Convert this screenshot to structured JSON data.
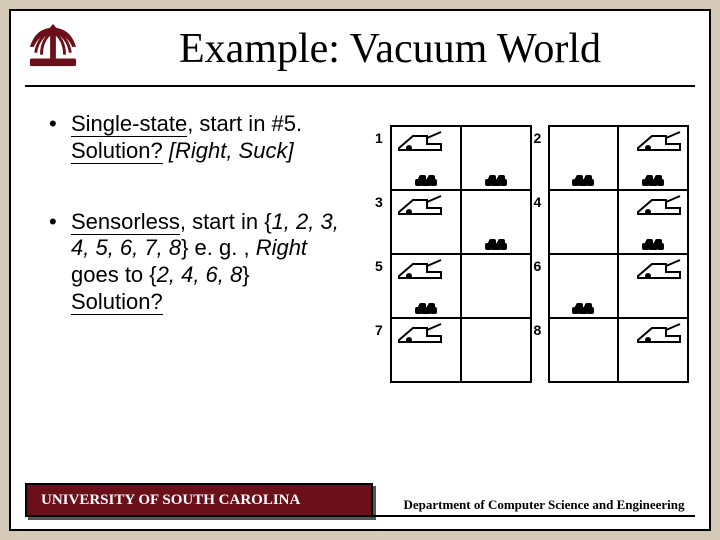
{
  "title": "Example: Vacuum World",
  "bullets": [
    {
      "lead": "Single-state",
      "tail1": ", start in #5.",
      "q": "Solution?",
      "ans": " [Right, Suck]"
    },
    {
      "lead": "Sensorless",
      "tail1": ", start in {",
      "set1": "1, 2, 3, 4, 5, 6, 7, 8",
      "tail2": "} e. g. , ",
      "right": "Right",
      "tail3": " goes to {",
      "set2": "2, 4, 6, 8",
      "tail4": "}",
      "q": "Solution?"
    }
  ],
  "states": [
    {
      "n": 1,
      "vac": "L",
      "dirtL": true,
      "dirtR": true
    },
    {
      "n": 2,
      "vac": "R",
      "dirtL": true,
      "dirtR": true
    },
    {
      "n": 3,
      "vac": "L",
      "dirtL": false,
      "dirtR": true
    },
    {
      "n": 4,
      "vac": "R",
      "dirtL": false,
      "dirtR": true
    },
    {
      "n": 5,
      "vac": "L",
      "dirtL": true,
      "dirtR": false
    },
    {
      "n": 6,
      "vac": "R",
      "dirtL": true,
      "dirtR": false
    },
    {
      "n": 7,
      "vac": "L",
      "dirtL": false,
      "dirtR": false
    },
    {
      "n": 8,
      "vac": "R",
      "dirtL": false,
      "dirtR": false
    }
  ],
  "footer": {
    "left": "UNIVERSITY OF SOUTH CAROLINA",
    "right": "Department of Computer Science and Engineering"
  }
}
